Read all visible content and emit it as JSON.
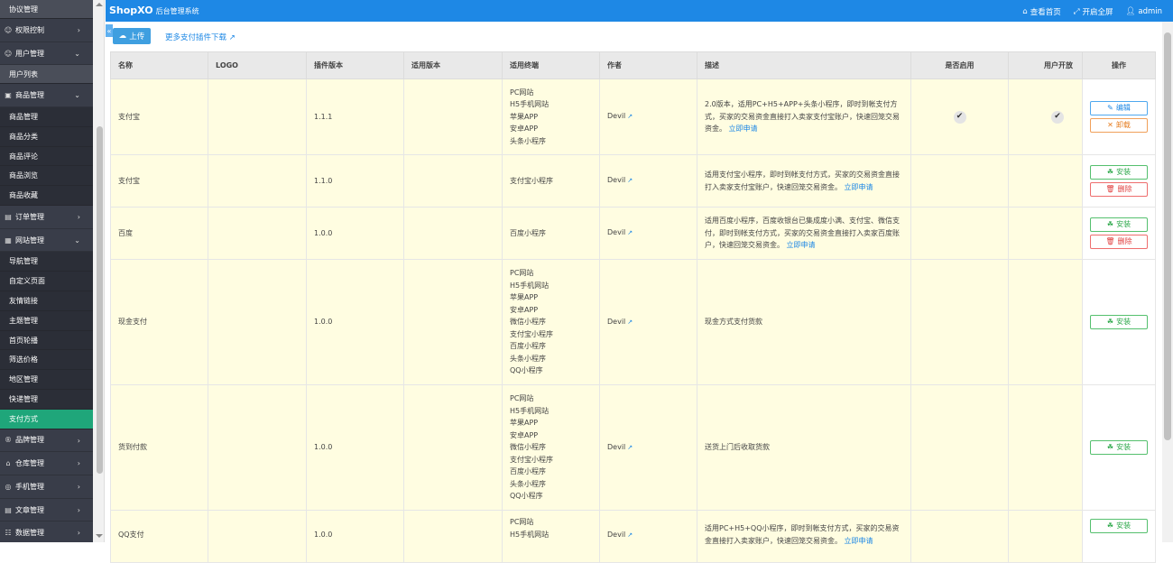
{
  "header": {
    "brand": "ShopXO",
    "subtitle": "后台管理系统",
    "links": [
      "查看首页",
      "开启全屏",
      "admin"
    ]
  },
  "sidebar": {
    "agreement": "协议管理",
    "menus": [
      {
        "label": "权限控制"
      },
      {
        "label": "用户管理"
      },
      {
        "label": "商品管理"
      },
      {
        "label": "订单管理"
      },
      {
        "label": "网站管理"
      },
      {
        "label": "品牌管理"
      },
      {
        "label": "仓库管理"
      },
      {
        "label": "手机管理"
      },
      {
        "label": "文章管理"
      },
      {
        "label": "数据管理"
      }
    ],
    "user_sub": [
      "用户列表"
    ],
    "goods_sub": [
      "商品管理",
      "商品分类",
      "商品评论",
      "商品浏览",
      "商品收藏"
    ],
    "site_sub": [
      "导航管理",
      "自定义页面",
      "友情链接",
      "主题管理",
      "首页轮播",
      "筛选价格",
      "地区管理",
      "快递管理",
      "支付方式"
    ]
  },
  "toolbar": {
    "collapse": "«",
    "upload": "上传",
    "more": "更多支付插件下载"
  },
  "table": {
    "headers": [
      "名称",
      "LOGO",
      "插件版本",
      "适用版本",
      "适用终端",
      "作者",
      "描述",
      "是否启用",
      "用户开放",
      "操作"
    ],
    "rows": [
      {
        "name": "支付宝",
        "version": "1.1.1",
        "terminals": [
          "PC网站",
          "H5手机网站",
          "苹果APP",
          "安卓APP",
          "头条小程序"
        ],
        "author": "Devil",
        "desc": "2.0版本，适用PC+H5+APP+头条小程序，即时到帐支付方式，买家的交易资金直接打入卖家支付宝账户，快速回笼交易资金。",
        "apply": "立即申请",
        "enabled": "✔",
        "open": "✔",
        "btn1": "编辑",
        "btn2": "卸载"
      },
      {
        "name": "支付宝",
        "version": "1.1.0",
        "terminals": [
          "支付宝小程序"
        ],
        "author": "Devil",
        "desc": "适用支付宝小程序，即时到帐支付方式，买家的交易资金直接打入卖家支付宝账户，快速回笼交易资金。",
        "apply": "立即申请",
        "btn1": "安装",
        "btn2": "删除"
      },
      {
        "name": "百度",
        "version": "1.0.0",
        "terminals": [
          "百度小程序"
        ],
        "author": "Devil",
        "desc": "适用百度小程序，百度收银台已集成度小满、支付宝、微信支付，即时到帐支付方式，买家的交易资金直接打入卖家百度账户，快速回笼交易资金。",
        "apply": "立即申请",
        "btn1": "安装",
        "btn2": "删除"
      },
      {
        "name": "现金支付",
        "version": "1.0.0",
        "terminals": [
          "PC网站",
          "H5手机网站",
          "苹果APP",
          "安卓APP",
          "微信小程序",
          "支付宝小程序",
          "百度小程序",
          "头条小程序",
          "QQ小程序"
        ],
        "author": "Devil",
        "desc": "现金方式支付货款",
        "btn1": "安装"
      },
      {
        "name": "货到付款",
        "version": "1.0.0",
        "terminals": [
          "PC网站",
          "H5手机网站",
          "苹果APP",
          "安卓APP",
          "微信小程序",
          "支付宝小程序",
          "百度小程序",
          "头条小程序",
          "QQ小程序"
        ],
        "author": "Devil",
        "desc": "送货上门后收取货款",
        "btn1": "安装"
      },
      {
        "name": "QQ支付",
        "version": "1.0.0",
        "terminals": [
          "PC网站",
          "H5手机网站"
        ],
        "author": "Devil",
        "desc": "适用PC+H5+QQ小程序，即时到帐支付方式，买家的交易资金直接打入卖家账户，快速回笼交易资金。",
        "apply": "立即申请",
        "btn1": "安装"
      }
    ]
  }
}
